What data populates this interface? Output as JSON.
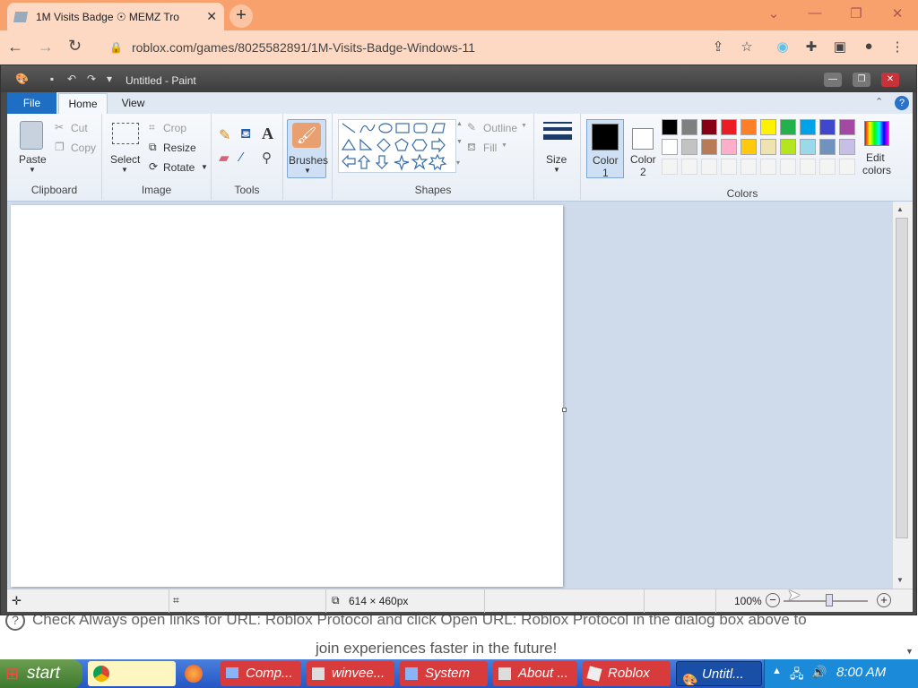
{
  "browser": {
    "tab_title": "1M Visits Badge ☉ MEMZ Tro",
    "tab_close": "✕",
    "new_tab": "+",
    "url": "roblox.com/games/8025582891/1M-Visits-Badge-Windows-11",
    "window_controls": [
      "⌄",
      "—",
      "❐",
      "✕"
    ]
  },
  "page": {
    "help_line": "Check Always open links for URL: Roblox Protocol and click Open URL: Roblox Protocol in the dialog box above to",
    "help_line2": "join experiences faster in the future!"
  },
  "paint": {
    "title": "Untitled - Paint",
    "tabs": {
      "file": "File",
      "home": "Home",
      "view": "View"
    },
    "clipboard": {
      "paste": "Paste",
      "cut": "Cut",
      "copy": "Copy",
      "label": "Clipboard"
    },
    "image": {
      "select": "Select",
      "crop": "Crop",
      "resize": "Resize",
      "rotate": "Rotate",
      "label": "Image"
    },
    "tools": {
      "label": "Tools"
    },
    "brushes": "Brushes",
    "shapes": {
      "outline": "Outline",
      "fill": "Fill",
      "label": "Shapes"
    },
    "size": "Size",
    "color1": {
      "line1": "Color",
      "line2": "1"
    },
    "color2": {
      "line1": "Color",
      "line2": "2"
    },
    "edit_colors": {
      "line1": "Edit",
      "line2": "colors"
    },
    "colors_label": "Colors",
    "palette_row1": [
      "#000000",
      "#7f7f7f",
      "#880015",
      "#ed1c24",
      "#ff7f27",
      "#fff200",
      "#22b14c",
      "#00a2e8",
      "#3f48cc",
      "#a349a4"
    ],
    "palette_row2": [
      "#ffffff",
      "#c3c3c3",
      "#b97a57",
      "#ffaec9",
      "#ffc90e",
      "#efe4b0",
      "#b5e61d",
      "#99d9ea",
      "#7092be",
      "#c8bfe7"
    ],
    "status": {
      "dimensions": "614 × 460px",
      "zoom": "100%"
    }
  },
  "taskbar": {
    "start": "start",
    "items": [
      "Comp...",
      "winvee...",
      "System",
      "About ...",
      "Roblox",
      "Untitl..."
    ],
    "clock": "8:00 AM"
  }
}
